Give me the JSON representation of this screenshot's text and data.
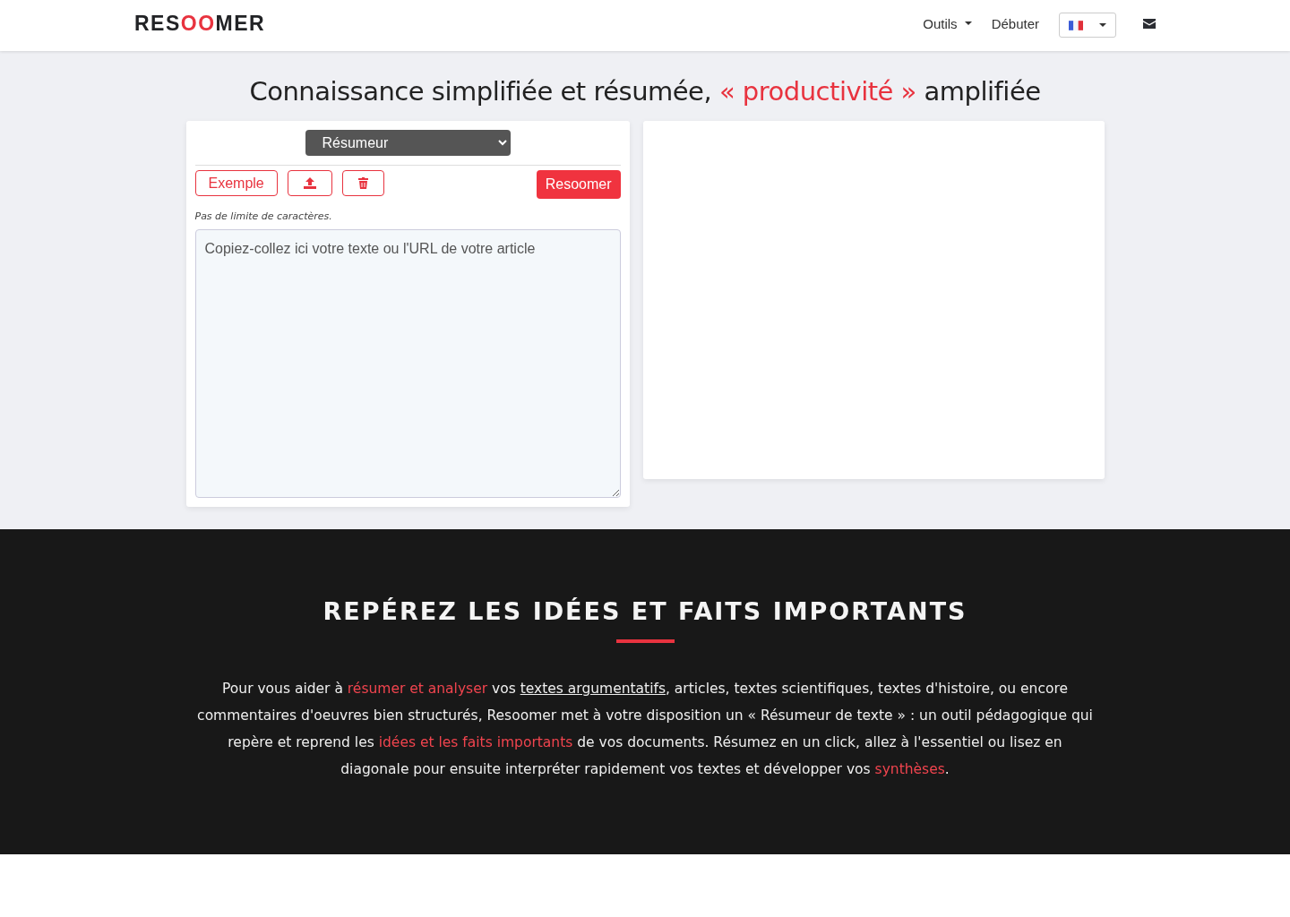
{
  "header": {
    "logo": [
      {
        "text": "RES",
        "kind": "plain"
      },
      {
        "text": "OO",
        "kind": "accent"
      },
      {
        "text": "MER",
        "kind": "plain"
      }
    ],
    "nav": [
      {
        "label": "Outils",
        "kind": "dropdown"
      },
      {
        "label": "Débuter",
        "kind": "link"
      },
      {
        "kind": "flag"
      },
      {
        "kind": "mail"
      }
    ]
  },
  "hero": {
    "title": [
      {
        "text": "Connaissance simplifiée et résumée, ",
        "kind": "plain"
      },
      {
        "text": "« productivité »",
        "kind": "accent"
      },
      {
        "text": " amplifiée",
        "kind": "plain"
      }
    ]
  },
  "editor": {
    "mode": "Résumeur",
    "buttons": [
      {
        "kind": "text",
        "label": "Exemple"
      },
      {
        "kind": "upload"
      },
      {
        "kind": "delete"
      }
    ],
    "submit": "Resoomer",
    "hint": "Pas de limite de caractères.",
    "placeholder": "Copiez-collez ici votre texte ou l'URL de votre article"
  },
  "section": {
    "title": "REPÉREZ LES IDÉES ET FAITS IMPORTANTS",
    "paragraph": [
      {
        "text": "Pour vous aider à ",
        "kind": "plain"
      },
      {
        "text": "résumer et analyser",
        "kind": "link"
      },
      {
        "text": " vos ",
        "kind": "plain"
      },
      {
        "text": "textes argumentatifs",
        "kind": "underline"
      },
      {
        "text": ", articles, textes scientifiques, textes d'histoire, ou encore commentaires d'oeuvres bien structurés, Resoomer met à votre disposition un « Résumeur de texte » : un outil pédagogique qui repère et reprend les ",
        "kind": "plain"
      },
      {
        "text": "idées et les faits importants",
        "kind": "link"
      },
      {
        "text": " de vos documents. Résumez en un click, allez à l'essentiel ou lisez en diagonale pour ensuite interpréter rapidement vos textes et développer vos ",
        "kind": "plain"
      },
      {
        "text": "synthèses",
        "kind": "link"
      },
      {
        "text": ".",
        "kind": "plain"
      }
    ]
  }
}
